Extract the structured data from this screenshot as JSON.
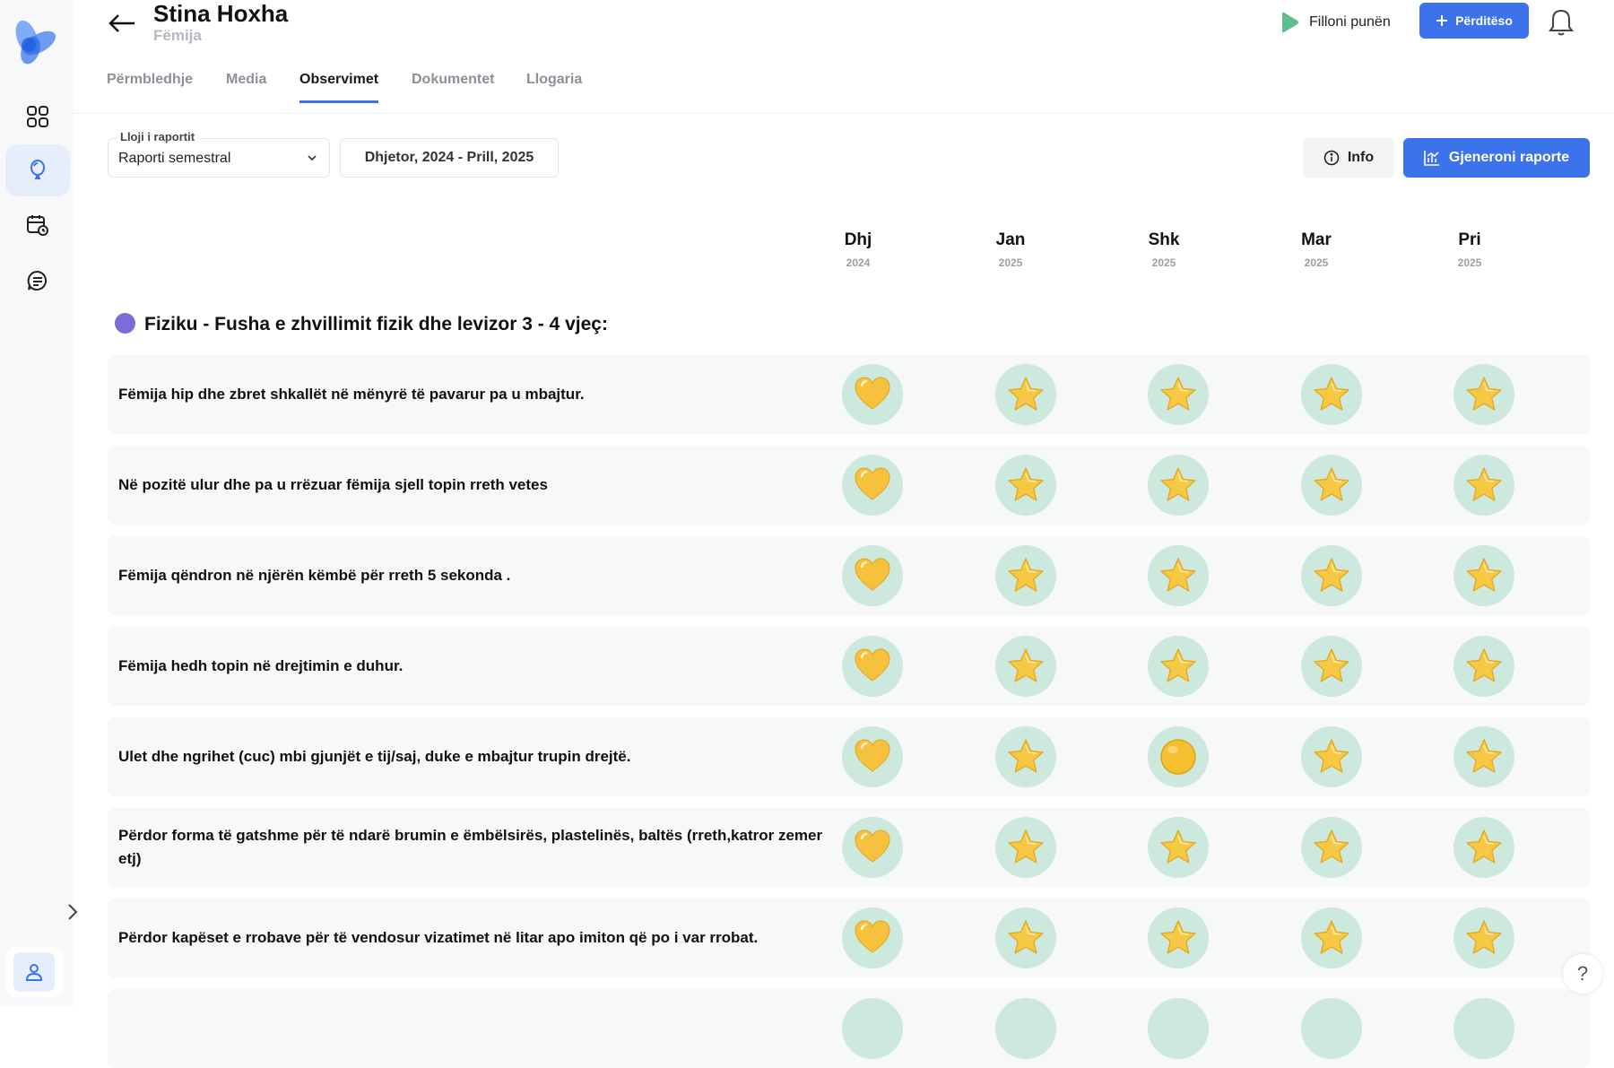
{
  "header": {
    "title": "Stina Hoxha",
    "subtitle": "Fëmija",
    "start_work_label": "Filloni punën",
    "update_label": "Përditëso"
  },
  "tabs": [
    {
      "label": "Përmbledhje",
      "active": false
    },
    {
      "label": "Media",
      "active": false
    },
    {
      "label": "Observimet",
      "active": true
    },
    {
      "label": "Dokumentet",
      "active": false
    },
    {
      "label": "Llogaria",
      "active": false
    }
  ],
  "toolbar": {
    "report_type_label": "Lloji i raportit",
    "report_type_value": "Raporti semestral",
    "date_range": "Dhjetor, 2024 - Prill, 2025",
    "info_label": "Info",
    "generate_label": "Gjeneroni raporte"
  },
  "months": [
    {
      "name": "Dhj",
      "year": "2024"
    },
    {
      "name": "Jan",
      "year": "2025"
    },
    {
      "name": "Shk",
      "year": "2025"
    },
    {
      "name": "Mar",
      "year": "2025"
    },
    {
      "name": "Pri",
      "year": "2025"
    }
  ],
  "section": {
    "title": "Fiziku - Fusha e zhvillimit fizik dhe levizor 3 - 4 vjeç:",
    "dot_color": "#7b6dd6"
  },
  "rows": [
    {
      "text": "Fëmija hip dhe zbret shkallët në mënyrë të pavarur pa u mbajtur.",
      "ratings": [
        "heart-icon",
        "star-icon",
        "star-icon",
        "star-icon",
        "star-icon"
      ]
    },
    {
      "text": "Në pozitë ulur dhe pa u rrëzuar fëmija sjell topin rreth vetes",
      "ratings": [
        "heart-icon",
        "star-icon",
        "star-icon",
        "star-icon",
        "star-icon"
      ]
    },
    {
      "text": "Fëmija qëndron në njërën këmbë për rreth 5 sekonda .",
      "ratings": [
        "heart-icon",
        "star-icon",
        "star-icon",
        "star-icon",
        "star-icon"
      ]
    },
    {
      "text": "Fëmija hedh topin në drejtimin e duhur.",
      "ratings": [
        "heart-icon",
        "star-icon",
        "star-icon",
        "star-icon",
        "star-icon"
      ]
    },
    {
      "text": "Ulet dhe ngrihet (cuc) mbi gjunjët e tij/saj, duke e mbajtur trupin drejtë.",
      "ratings": [
        "heart-icon",
        "star-icon",
        "circle-icon",
        "star-icon",
        "star-icon"
      ]
    },
    {
      "text": "Përdor forma të gatshme për të ndarë brumin e ëmbëlsirës, plastelinës, baltës (rreth,katror zemer etj)",
      "ratings": [
        "heart-icon",
        "star-icon",
        "star-icon",
        "star-icon",
        "star-icon"
      ]
    },
    {
      "text": "Përdor kapëset e rrobave për të vendosur vizatimet në litar apo imiton që po i var rrobat.",
      "ratings": [
        "heart-icon",
        "star-icon",
        "star-icon",
        "star-icon",
        "star-icon"
      ]
    },
    {
      "text": "",
      "ratings": [
        "blank-icon",
        "blank-icon",
        "blank-icon",
        "blank-icon",
        "blank-icon"
      ]
    }
  ],
  "colors": {
    "accent": "#3d73ea",
    "badge_bg": "#cde8dc",
    "row_bg": "#f7f8f9",
    "play_icon": "#5fbf8c"
  },
  "help_label": "?"
}
